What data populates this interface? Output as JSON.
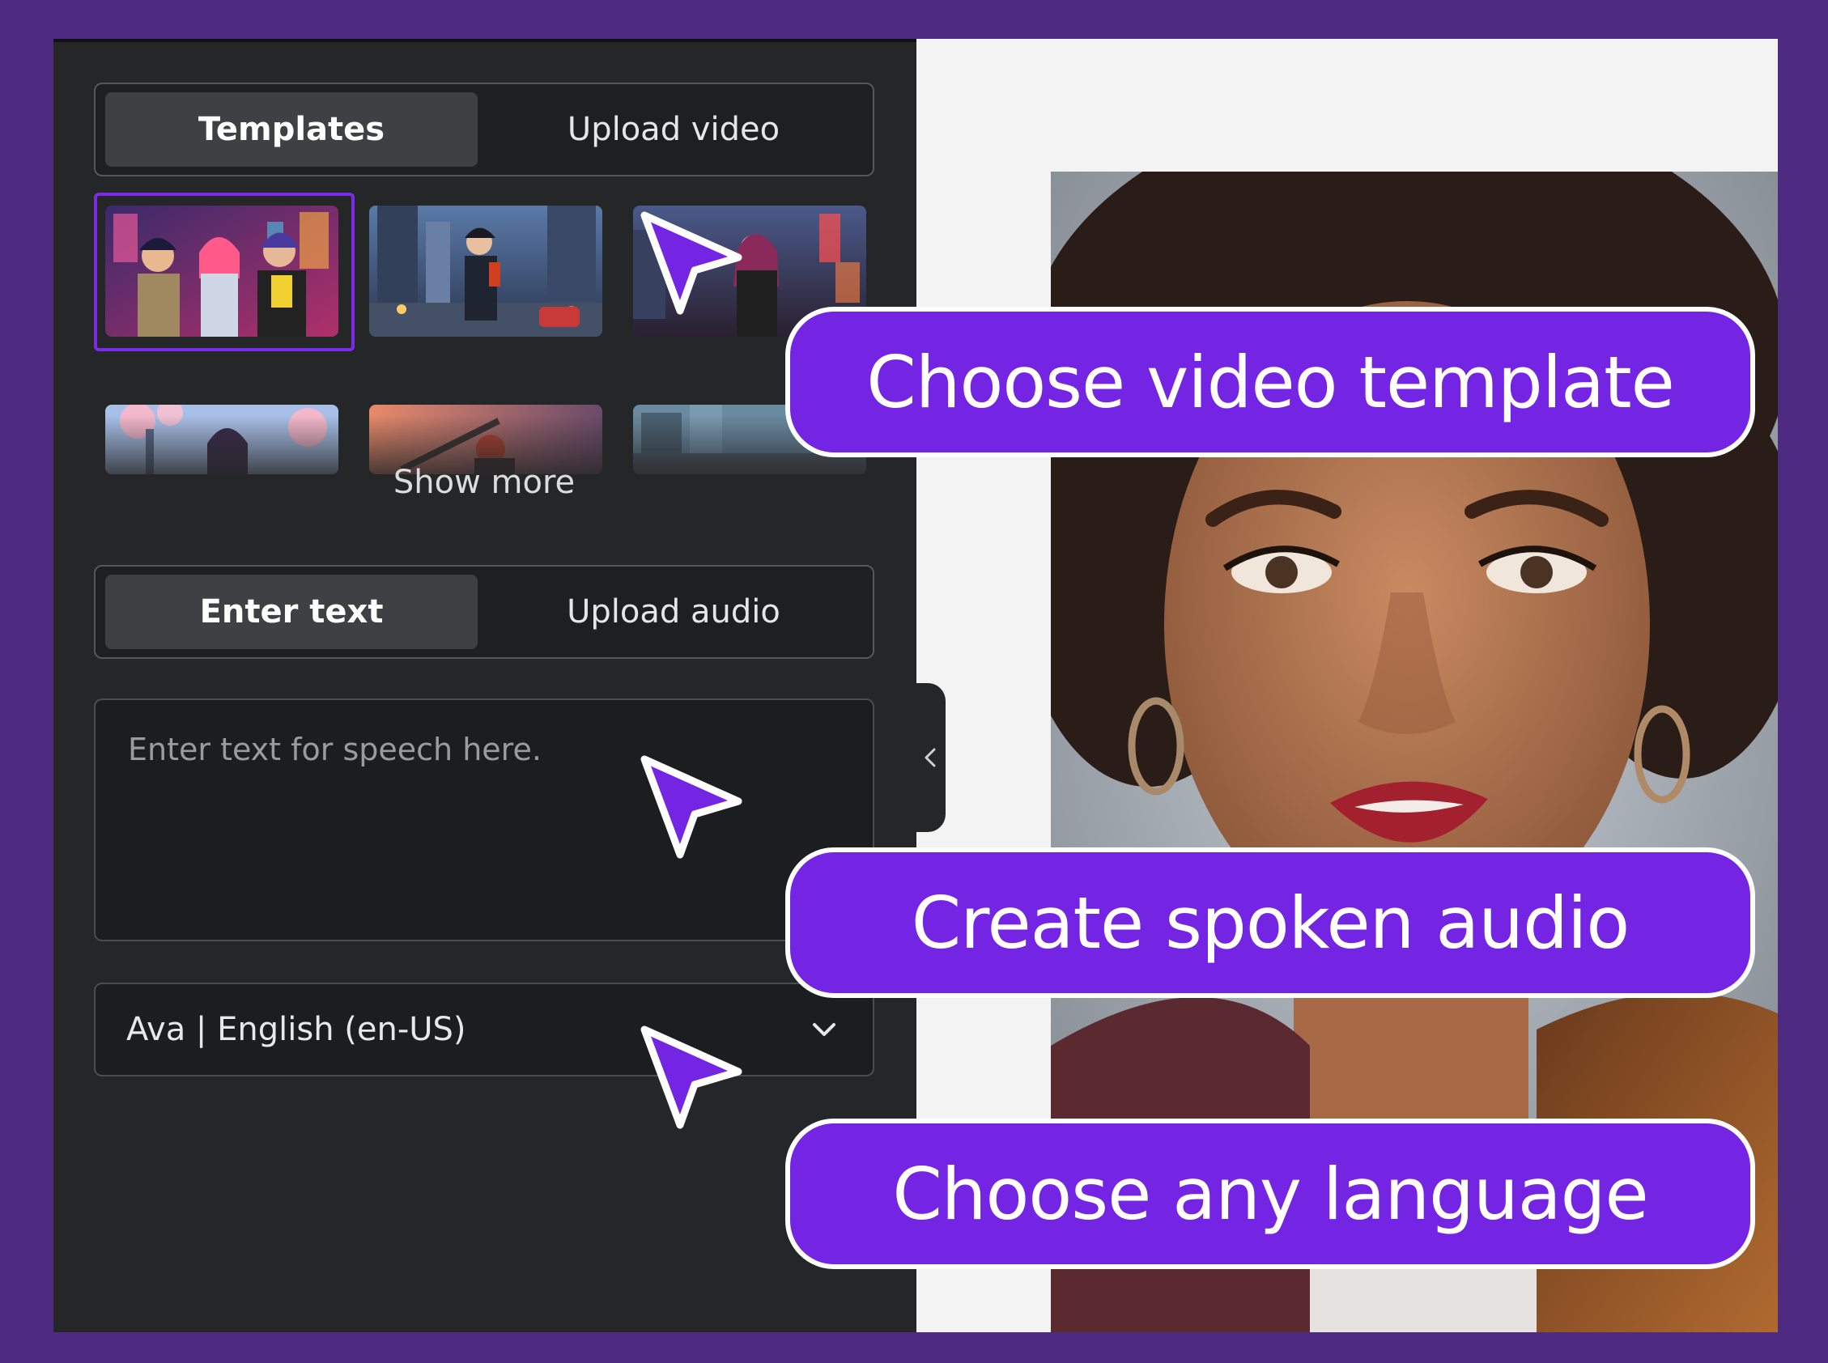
{
  "media_tabs": {
    "templates": "Templates",
    "upload_video": "Upload video",
    "active": "Templates"
  },
  "templates": {
    "items": [
      {
        "name": "anime-group-neon-city",
        "selected": true
      },
      {
        "name": "anime-boy-city-street",
        "selected": false
      },
      {
        "name": "anime-girl-night-street",
        "selected": false
      },
      {
        "name": "anime-girl-cherry-blossoms",
        "selected": false
      },
      {
        "name": "anime-sunset-sword",
        "selected": false
      },
      {
        "name": "anime-city-street-day",
        "selected": false
      }
    ],
    "show_more": "Show more"
  },
  "audio_tabs": {
    "enter_text": "Enter text",
    "upload_audio": "Upload audio",
    "active": "Enter text"
  },
  "speech": {
    "placeholder": "Enter text for speech here.",
    "value": ""
  },
  "voice": {
    "selected": "Ava | English (en-US)",
    "icon": "chevron-down-icon"
  },
  "callouts": {
    "template": "Choose video template",
    "audio": "Create spoken audio",
    "language": "Choose any language"
  },
  "colors": {
    "background": "#4e2b80",
    "panel": "#252627",
    "accent": "#7424e3",
    "selection": "#7d2ae8"
  }
}
